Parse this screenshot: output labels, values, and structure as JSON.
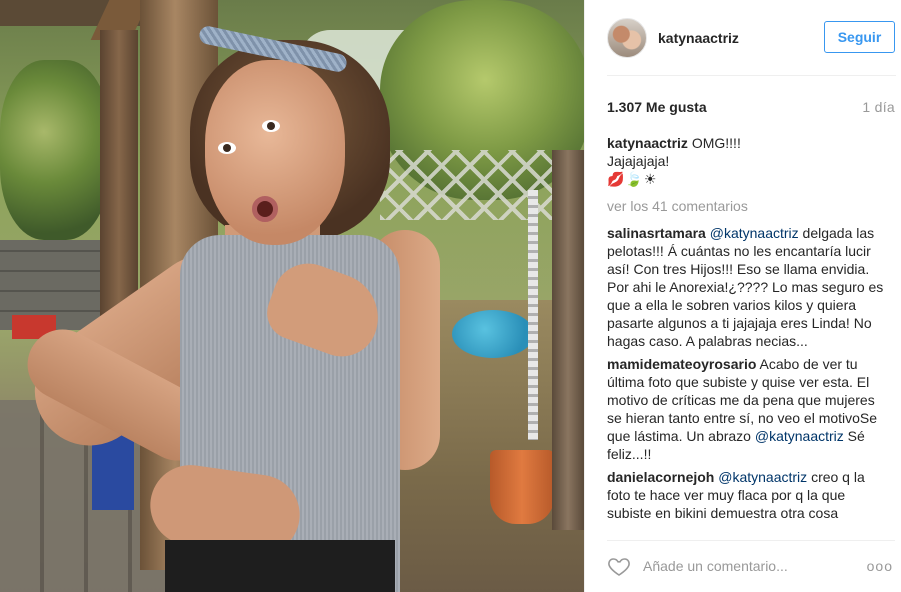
{
  "post": {
    "photo_alt": "woman posing in garden"
  },
  "header": {
    "username": "katynaactriz",
    "follow_label": "Seguir"
  },
  "stats": {
    "likes": "1.307 Me gusta",
    "age": "1 día"
  },
  "caption": {
    "user": "katynaactriz",
    "line1": "OMG!!!!",
    "line2": "Jajajajaja!",
    "emoji": "💋🍃☀"
  },
  "view_all": "ver los 41 comentarios",
  "comments": [
    {
      "user": "salinasrtamara",
      "mention": "@katynaactriz",
      "text": "delgada las pelotas!!! Á cuántas no les encantaría lucir así! Con tres Hijos!!! Eso se llama envidia. Por ahi le Anorexia!¿???? Lo mas seguro es que a ella le sobren varios kilos y quiera pasarte algunos a ti jajajaja eres Linda! No hagas caso. A palabras necias..."
    },
    {
      "user": "mamidemateoyrosario",
      "text": "Acabo de ver tu última foto que subiste y quise ver esta. El motivo de críticas me da pena que mujeres se hieran tanto entre sí, no veo el motivoSe que lástima. Un abrazo",
      "mention_end": "@katynaactriz",
      "text_end": "Sé feliz...!!"
    },
    {
      "user": "danielacornejoh",
      "mention": "@katynaactriz",
      "text": "creo q la foto te hace ver muy flaca por q la que subiste en bikini demuestra otra cosa"
    }
  ],
  "comment_bar": {
    "placeholder": "Añade un comentario...",
    "more": "ooo",
    "heart_icon": "heart-outline-icon"
  },
  "colors": {
    "accent": "#3897f0",
    "mention": "#003569",
    "muted": "#999999",
    "text": "#262626"
  }
}
